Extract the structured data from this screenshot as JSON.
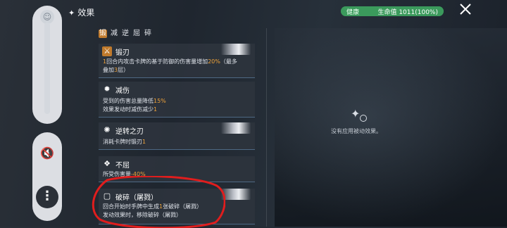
{
  "header": {
    "title": "效果",
    "health_label": "健康",
    "health_value": "生命值 1011(100%)",
    "health_fraction": 1.0
  },
  "icon_row": [
    "锻",
    "减",
    "逆",
    "屈",
    "碎"
  ],
  "cards": [
    {
      "name": "锻刃",
      "lines": [
        "1回合内攻击卡牌的基于防御的伤害量增加20%（最多",
        "叠加3层）"
      ]
    },
    {
      "name": "减伤",
      "lines": [
        "受到的伤害总量降低15%",
        "效果发动时减伤减少1"
      ]
    },
    {
      "name": "逆转之刃",
      "lines": [
        "消耗卡牌时锻刃1"
      ]
    },
    {
      "name": "不屈",
      "lines": [
        "所受伤害量-40%"
      ]
    },
    {
      "name": "破碎（屠戮）",
      "lines": [
        "回合开始时手牌中生成1张破碎（屠戮）",
        "发动效果时，移除破碎（屠戮）"
      ]
    }
  ],
  "right_panel": {
    "empty_text": "没有应用被动效果。"
  },
  "colors": {
    "accent": "#f0a33a",
    "health": "#3b9a5c",
    "annotation": "#e01d1d"
  }
}
